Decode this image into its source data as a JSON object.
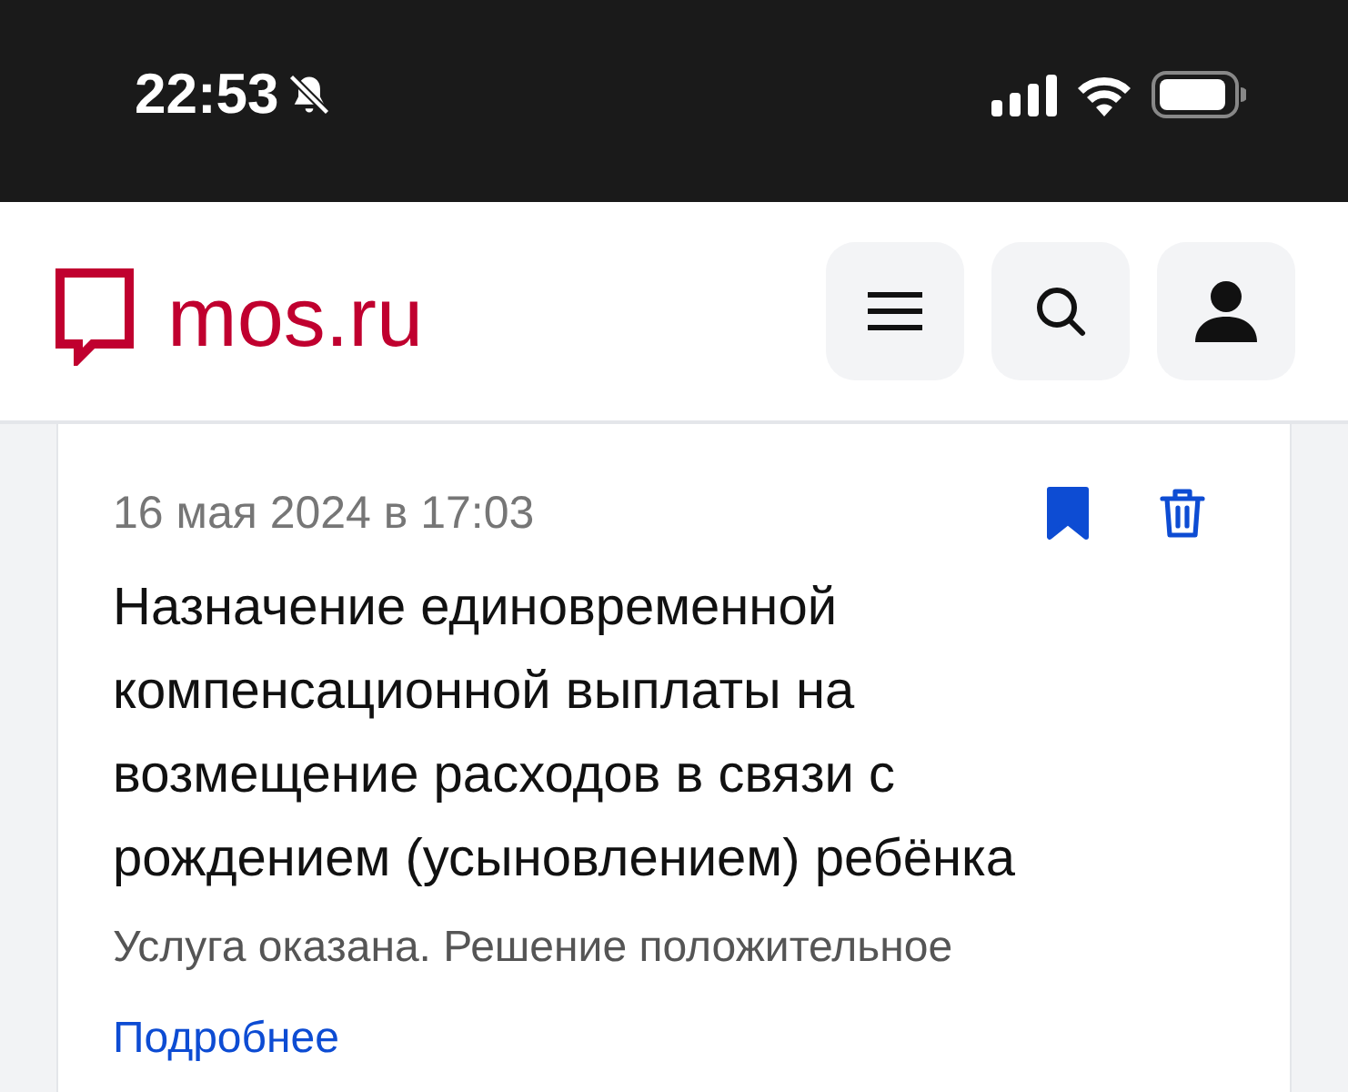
{
  "status_bar": {
    "time": "22:53",
    "silent": true
  },
  "header": {
    "logo": "mos.ru"
  },
  "card": {
    "date": "16 мая 2024 в 17:03",
    "bookmarked": true,
    "title": "Назначение единовременной компенсационной выплаты на возмещение расходов в связи с рождением (усыновлением) ребёнка",
    "status": "Услуга оказана. Решение положительное",
    "link": "Подробнее"
  }
}
